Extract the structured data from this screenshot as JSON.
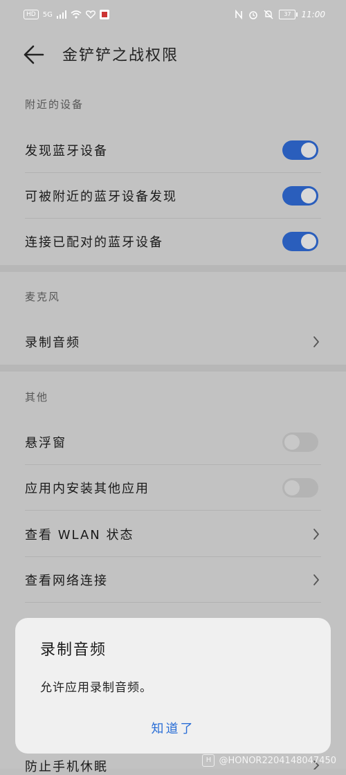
{
  "status_bar": {
    "left_badge": "HD",
    "network": "5G",
    "time": "11:00",
    "battery": "37"
  },
  "header": {
    "title": "金铲铲之战权限"
  },
  "sections": {
    "nearby": {
      "label": "附近的设备",
      "rows": [
        {
          "label": "发现蓝牙设备",
          "toggle": "on"
        },
        {
          "label": "可被附近的蓝牙设备发现",
          "toggle": "on"
        },
        {
          "label": "连接已配对的蓝牙设备",
          "toggle": "on"
        }
      ]
    },
    "microphone": {
      "label": "麦克风",
      "rows": [
        {
          "label": "录制音频"
        }
      ]
    },
    "other": {
      "label": "其他",
      "rows": [
        {
          "label": "悬浮窗",
          "toggle": "off"
        },
        {
          "label": "应用内安装其他应用",
          "toggle": "off"
        },
        {
          "label": "查看 WLAN 状态"
        },
        {
          "label": "查看网络连接"
        }
      ],
      "peek_label": "防止手机休眠"
    }
  },
  "dialog": {
    "title": "录制音频",
    "message": "允许应用录制音频。",
    "button": "知道了"
  },
  "watermark": "@HONOR2204148047450",
  "colors": {
    "accent": "#2a5ebc",
    "link": "#2a6ed6",
    "dim_background": "#c2c2c2"
  }
}
